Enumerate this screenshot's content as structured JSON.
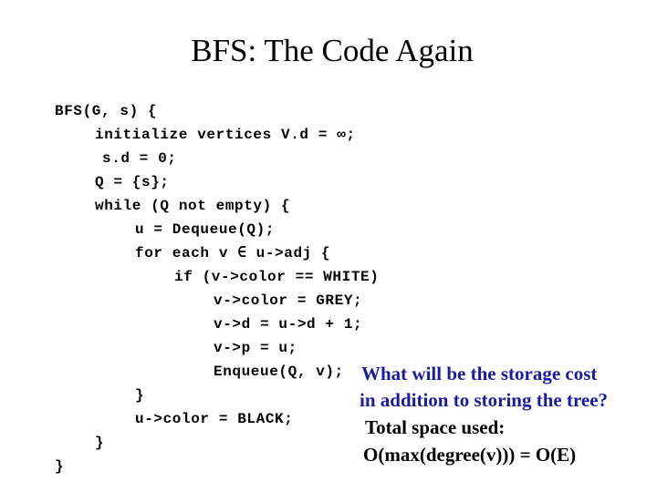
{
  "slide": {
    "title": "BFS: The Code Again",
    "code_lines": [
      "BFS(G, s) {",
      "initialize vertices V.d = ∞;",
      "s.d = 0;",
      "Q = {s};",
      "while (Q not empty) {",
      "u = Dequeue(Q);",
      "for each v ∈ u->adj {",
      "if (v->color == WHITE)",
      "v->color = GREY;",
      "v->d = u->d + 1;",
      "v->p = u;",
      "Enqueue(Q, v);",
      "}",
      "u->color = BLACK;",
      "}",
      "}"
    ],
    "question_lines": [
      "What will be the storage cost",
      "in addition to storing the tree?"
    ],
    "answer_lines": [
      "Total space used:",
      "O(max(degree(v))) = O(E)"
    ],
    "colors": {
      "question": "#1a1aa6",
      "answer": "#000000",
      "code": "#000000"
    }
  }
}
